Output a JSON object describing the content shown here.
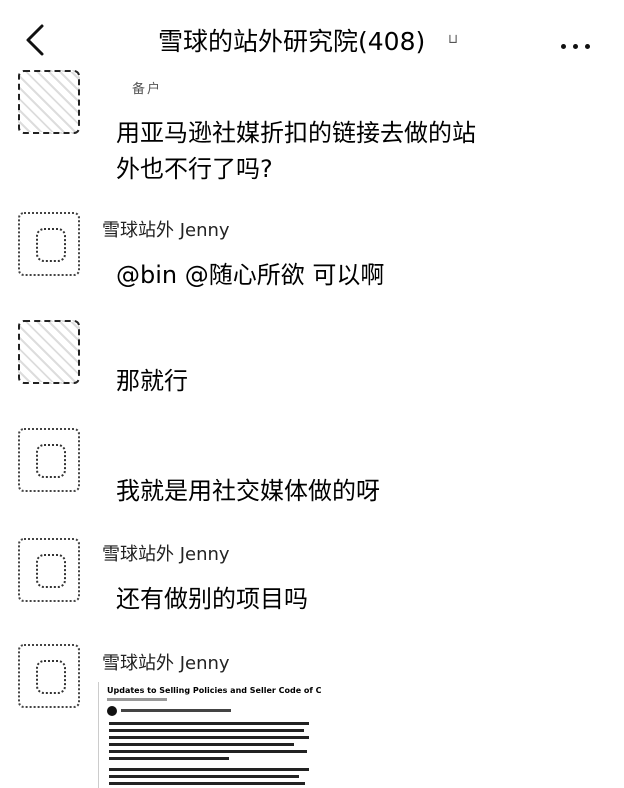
{
  "header": {
    "back_icon": "chevron-left-icon",
    "title": "雪球的站外研究院(408)",
    "title_mark": "⊔",
    "more_icon": "more-dots-icon"
  },
  "messages": [
    {
      "sender": "备户",
      "text_lines": [
        "用亚马逊社媒折扣的链接去做的站",
        "外也不行了吗?"
      ]
    },
    {
      "sender": "雪球站外 Jenny",
      "text_lines": [
        "@bin @随心所欲  可以啊"
      ]
    },
    {
      "sender": "",
      "text_lines": [
        "那就行"
      ]
    },
    {
      "sender": "",
      "text_lines": [
        "我就是用社交媒体做的呀"
      ]
    },
    {
      "sender": "雪球站外 Jenny",
      "text_lines": [
        "还有做别的项目吗"
      ]
    },
    {
      "sender": "雪球站外 Jenny",
      "text_lines": []
    }
  ],
  "attachment": {
    "title": "Updates to Selling Policies and Seller Code of Conduct"
  }
}
